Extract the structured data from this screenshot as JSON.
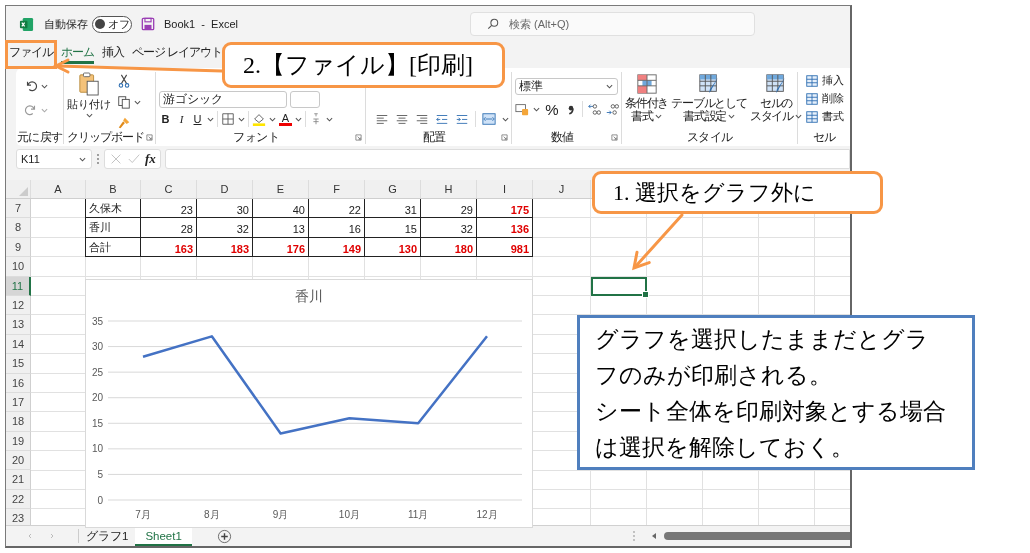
{
  "title_bar": {
    "autosave_label": "自動保存",
    "autosave_toggle": {
      "label": "オフ",
      "on": false
    },
    "title": "Book1  -  Excel",
    "search": {
      "placeholder": "検索 (Alt+Q)"
    }
  },
  "ribbon_tabs": [
    {
      "label": "ファイル",
      "selected": false
    },
    {
      "label": "ホーム",
      "selected": true
    },
    {
      "label": "挿入",
      "selected": false
    },
    {
      "label": "ページ レイアウト",
      "selected": false
    }
  ],
  "ribbon": {
    "undo": {
      "label": "元に戻す"
    },
    "clipboard": {
      "paste_label": "貼り付け",
      "label": "クリップボード"
    },
    "font": {
      "font_name": "游ゴシック",
      "bold": "B",
      "italic": "I",
      "underline": "U",
      "font_color": "A",
      "label": "フォント"
    },
    "alignment": {
      "label": "配置"
    },
    "number": {
      "format": "標準",
      "percent": "%",
      "label": "数値"
    },
    "styles": {
      "buttons": [
        {
          "lines": [
            "条件付き",
            "書式"
          ]
        },
        {
          "lines": [
            "テーブルとして",
            "書式設定"
          ]
        },
        {
          "lines": [
            "セルの",
            "スタイル"
          ]
        }
      ],
      "label": "スタイル"
    },
    "cells": {
      "buttons": [
        "挿入",
        "削除",
        "書式"
      ],
      "label": "セル"
    }
  },
  "formula_bar": {
    "name_box": "K11",
    "function_label": "fx"
  },
  "sheet": {
    "columns": [
      "A",
      "B",
      "C",
      "D",
      "E",
      "F",
      "G",
      "H",
      "I",
      "J"
    ],
    "rows": [
      {
        "label": "7",
        "selected": false,
        "cells": [
          {
            "text": "久保木",
            "kind": "label",
            "total": false
          },
          {
            "text": "23",
            "kind": "number",
            "total": false
          },
          {
            "text": "30",
            "kind": "number",
            "total": false
          },
          {
            "text": "40",
            "kind": "number",
            "total": false
          },
          {
            "text": "22",
            "kind": "number",
            "total": false
          },
          {
            "text": "31",
            "kind": "number",
            "total": false
          },
          {
            "text": "29",
            "kind": "number",
            "total": false
          },
          {
            "text": "175",
            "kind": "number",
            "total": true
          }
        ]
      },
      {
        "label": "8",
        "selected": false,
        "cells": [
          {
            "text": "香川",
            "kind": "label",
            "total": false
          },
          {
            "text": "28",
            "kind": "number",
            "total": false
          },
          {
            "text": "32",
            "kind": "number",
            "total": false
          },
          {
            "text": "13",
            "kind": "number",
            "total": false
          },
          {
            "text": "16",
            "kind": "number",
            "total": false
          },
          {
            "text": "15",
            "kind": "number",
            "total": false
          },
          {
            "text": "32",
            "kind": "number",
            "total": false
          },
          {
            "text": "136",
            "kind": "number",
            "total": true
          }
        ]
      },
      {
        "label": "9",
        "selected": false,
        "cells": [
          {
            "text": "合計",
            "kind": "label",
            "total": false
          },
          {
            "text": "163",
            "kind": "number",
            "total": true
          },
          {
            "text": "183",
            "kind": "number",
            "total": true
          },
          {
            "text": "176",
            "kind": "number",
            "total": true
          },
          {
            "text": "149",
            "kind": "number",
            "total": true
          },
          {
            "text": "130",
            "kind": "number",
            "total": true
          },
          {
            "text": "180",
            "kind": "number",
            "total": true
          },
          {
            "text": "981",
            "kind": "number",
            "total": true
          }
        ]
      },
      {
        "label": "10",
        "selected": false
      },
      {
        "label": "11",
        "selected": true
      },
      {
        "label": "12",
        "selected": false
      },
      {
        "label": "13",
        "selected": false
      },
      {
        "label": "14",
        "selected": false
      },
      {
        "label": "15",
        "selected": false
      },
      {
        "label": "16",
        "selected": false
      },
      {
        "label": "17",
        "selected": false
      },
      {
        "label": "18",
        "selected": false
      },
      {
        "label": "19",
        "selected": false
      },
      {
        "label": "20",
        "selected": false
      },
      {
        "label": "21",
        "selected": false
      },
      {
        "label": "22",
        "selected": false
      },
      {
        "label": "23",
        "selected": false
      }
    ]
  },
  "chart": {
    "chart_data": {
      "type": "line",
      "title": "香川",
      "categories": [
        "7月",
        "8月",
        "9月",
        "10月",
        "11月",
        "12月"
      ],
      "series": [
        {
          "color": "#4472c4",
          "values": [
            28,
            32,
            13,
            16,
            15,
            32
          ]
        }
      ],
      "ylim": [
        0,
        35
      ],
      "yticks": [
        0,
        5,
        10,
        15,
        20,
        25,
        30,
        35
      ],
      "grid": true
    }
  },
  "sheet_tabs": [
    {
      "label": "グラフ1",
      "selected": false
    },
    {
      "label": "Sheet1",
      "selected": true
    }
  ],
  "annotations": {
    "step_1": "1.  選択をグラフ外に",
    "step_2": "2.【ファイル】[印刷]",
    "note": [
      "グラフを選択したままだとグラフのみが印刷される。",
      "シート全体を印刷対象とする場合は選択を解除しておく。"
    ]
  }
}
